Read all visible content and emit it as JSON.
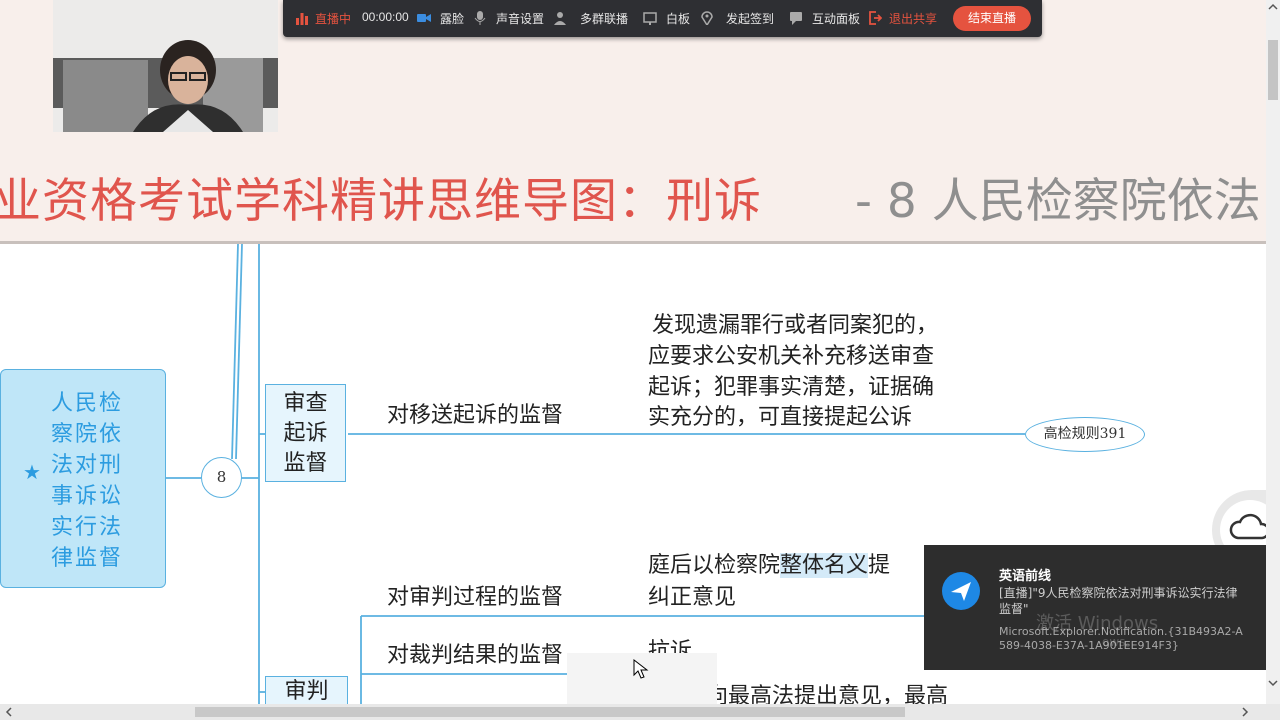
{
  "toolbar": {
    "live_status": "直播中",
    "timer": "00:00:00",
    "items": [
      "露脸",
      "声音设置",
      "多群联播",
      "白板",
      "发起签到",
      "互动面板",
      "退出共享"
    ],
    "end_button": "结束直播",
    "colors": {
      "background": "#2e2f33",
      "accent": "#e5533f"
    }
  },
  "header": {
    "title_main": "业资格考试学科精讲思维导图：刑诉",
    "title_sub": "- 8 人民检察院依法",
    "title_color": "#e0554d"
  },
  "mindmap": {
    "root": {
      "text": "人民检察院依法对刑事诉讼实行法律监督",
      "icon": "star-icon"
    },
    "chapter_number": "8",
    "node_review_prosecution": "审查起诉监督",
    "label_transfer": "对移送起诉的监督",
    "detail_transfer": [
      "发现遗漏罪行或者同案犯的，",
      "应要求公安机关补充移送审查",
      "起诉；犯罪事实清楚，证据确",
      "实充分的，可直接提起公诉"
    ],
    "tag_rule": "高检规则391",
    "label_trial_process": "对审判过程的监督",
    "detail_trial_process_part1": "庭后以检察院",
    "detail_trial_process_highlight": "整体名义",
    "detail_trial_process_part2": "提",
    "detail_trial_process_line2": "纠正意见",
    "label_trial_result": "对裁判结果的监督",
    "detail_trial_result": "抗诉",
    "node_trial": "审判",
    "detail_bottom": "最高检可以向最高法提出意见，最高"
  },
  "notification": {
    "app": "英语前线",
    "body": "[直播]\"9人民检察院依法对刑事诉讼实行法律监督\"",
    "source": "Microsoft.Explorer.Notification.{31B493A2-A589-4038-E37A-1A901EE914F3}",
    "watermark": "激活 Windows",
    "watermark_sub": "ows。"
  }
}
